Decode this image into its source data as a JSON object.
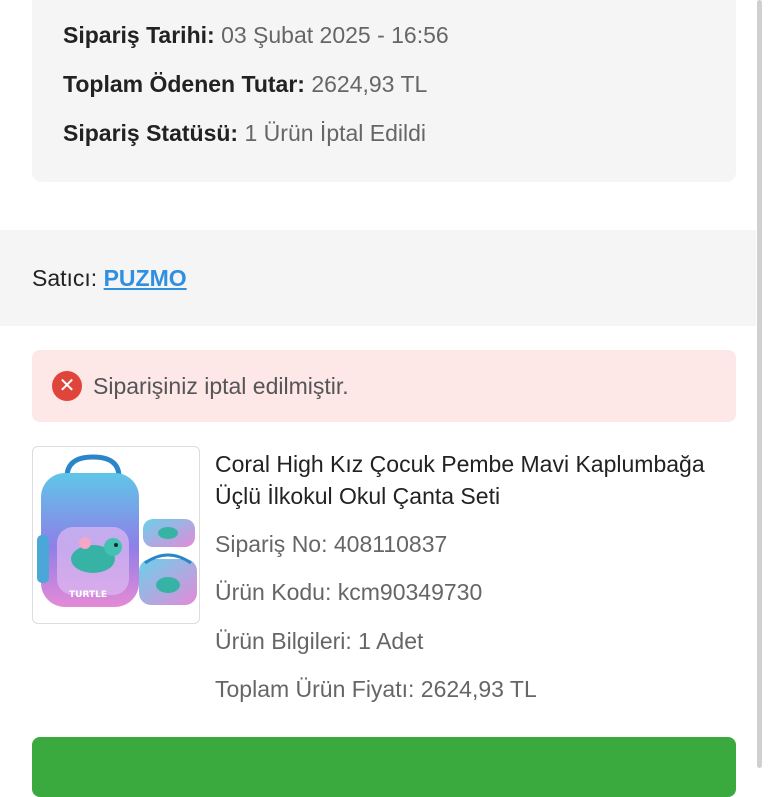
{
  "order_summary": {
    "date_label": "Sipariş Tarihi:",
    "date_value": "03 Şubat 2025 - 16:56",
    "total_label": "Toplam Ödenen Tutar:",
    "total_value": "2624,93 TL",
    "status_label": "Sipariş Statüsü:",
    "status_value": "1 Ürün İptal Edildi"
  },
  "seller": {
    "label": "Satıcı:",
    "name": "PUZMO"
  },
  "alert": {
    "message": "Siparişiniz iptal edilmiştir.",
    "icon": "cancel-circle-icon",
    "color": "#e0453b"
  },
  "product": {
    "title": "Coral High Kız Çocuk Pembe Mavi Kaplumbağa Üçlü İlkokul Okul Çanta Seti",
    "order_no": "Sipariş No: 408110837",
    "product_code": "Ürün Kodu: kcm90349730",
    "info": "Ürün Bilgileri: 1 Adet",
    "price": "Toplam Ürün Fiyatı: 2624,93 TL",
    "image_text": "TURTLE"
  },
  "action_button": {
    "color": "#3aa93e"
  },
  "colors": {
    "link": "#2f8fe0",
    "alert_bg": "#fde7e7",
    "card_bg": "#f5f5f5"
  }
}
